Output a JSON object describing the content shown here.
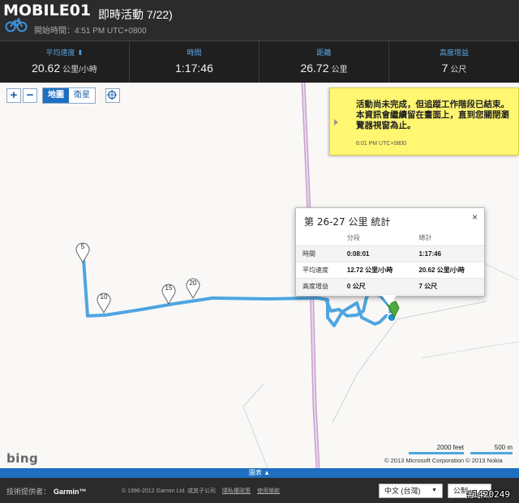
{
  "header": {
    "logo_text": "MOBILE01",
    "title": "即時活動 7/22)",
    "start_time": "開始時間：4:51 PM UTC+0800"
  },
  "stats": [
    {
      "label": "平均速度 ⬍",
      "value": "20.62",
      "unit": "公里/小時"
    },
    {
      "label": "時間",
      "value": "1:17:46",
      "unit": ""
    },
    {
      "label": "距離",
      "value": "26.72",
      "unit": "公里"
    },
    {
      "label": "高度增益",
      "value": "7",
      "unit": "公尺"
    }
  ],
  "map": {
    "zoom_in": "+",
    "zoom_out": "−",
    "type_map": "地圖",
    "type_satellite": "衛星",
    "note": {
      "message": "活動尚未完成，但追蹤工作階段已結束。 本資訊會繼續留在畫面上，直到您關閉瀏覽器視窗為止。",
      "time": "6:01 PM UTC+0800"
    },
    "markers": [
      "5",
      "10",
      "15",
      "20"
    ],
    "popup": {
      "title": "第 26-27 公里 統計",
      "close": "×",
      "col_segment": "分段",
      "col_total": "總計",
      "rows": [
        {
          "label": "時間",
          "segment": "0:08:01",
          "total": "1:17:46"
        },
        {
          "label": "平均速度",
          "segment": "12.72 公里/小時",
          "total": "20.62 公里/小時"
        },
        {
          "label": "高度增益",
          "segment": "0 公尺",
          "total": "7 公尺"
        }
      ]
    },
    "provider_logo": "bing",
    "scale_feet": "2000 feet",
    "scale_meters": "500 m",
    "copyright": "© 2013 Microsoft Corporation   © 2013 Nokia",
    "colors": {
      "track": "#4ea5e0",
      "road": "#c9a7d1",
      "accent": "#1f6fc1"
    }
  },
  "chart_toggle": "圖表 ▲",
  "footer": {
    "tech_label": "技術提供者：",
    "tech_brand": "Garmin™",
    "copyright": "© 1996-2012 Garmin Ltd. 或其子公司",
    "link_privacy": "隱私權政策",
    "link_terms": "使用條款",
    "language": "中文 (台灣)",
    "units": "公制"
  },
  "watermark": "#1420249"
}
